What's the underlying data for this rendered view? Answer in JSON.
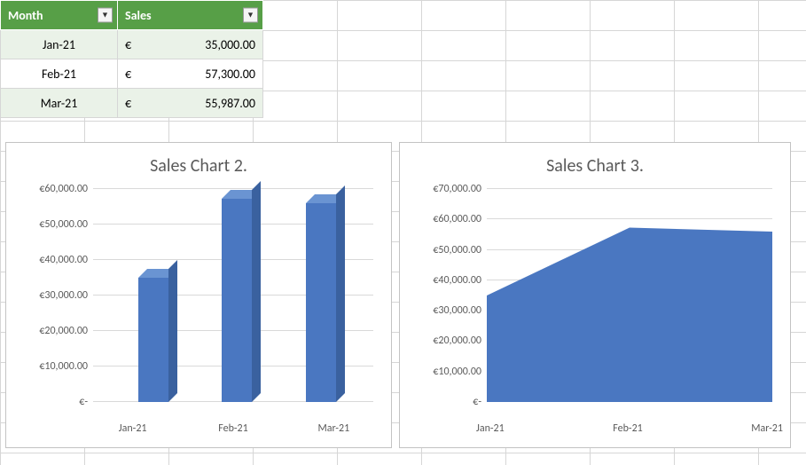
{
  "table": {
    "headers": {
      "month": "Month",
      "sales": "Sales"
    },
    "rows": [
      {
        "month": "Jan-21",
        "currency": "€",
        "amount": "35,000.00"
      },
      {
        "month": "Feb-21",
        "currency": "€",
        "amount": "57,300.00"
      },
      {
        "month": "Mar-21",
        "currency": "€",
        "amount": "55,987.00"
      }
    ]
  },
  "chart2": {
    "title": "Sales Chart 2.",
    "y_ticks": [
      "€60,000.00",
      "€50,000.00",
      "€40,000.00",
      "€30,000.00",
      "€20,000.00",
      "€10,000.00",
      "€-"
    ],
    "x_labels": [
      "Jan-21",
      "Feb-21",
      "Mar-21"
    ]
  },
  "chart3": {
    "title": "Sales Chart 3.",
    "y_ticks": [
      "€70,000.00",
      "€60,000.00",
      "€50,000.00",
      "€40,000.00",
      "€30,000.00",
      "€20,000.00",
      "€10,000.00",
      "€-"
    ],
    "x_labels": [
      "Jan-21",
      "Feb-21",
      "Mar-21"
    ]
  },
  "chart_data": [
    {
      "type": "bar",
      "title": "Sales Chart 2.",
      "categories": [
        "Jan-21",
        "Feb-21",
        "Mar-21"
      ],
      "values": [
        35000,
        57300,
        55987
      ],
      "xlabel": "",
      "ylabel": "",
      "ylim": [
        0,
        60000
      ],
      "currency": "EUR"
    },
    {
      "type": "area",
      "title": "Sales Chart 3.",
      "categories": [
        "Jan-21",
        "Feb-21",
        "Mar-21"
      ],
      "values": [
        35000,
        57300,
        55987
      ],
      "xlabel": "",
      "ylabel": "",
      "ylim": [
        0,
        70000
      ],
      "currency": "EUR"
    }
  ]
}
